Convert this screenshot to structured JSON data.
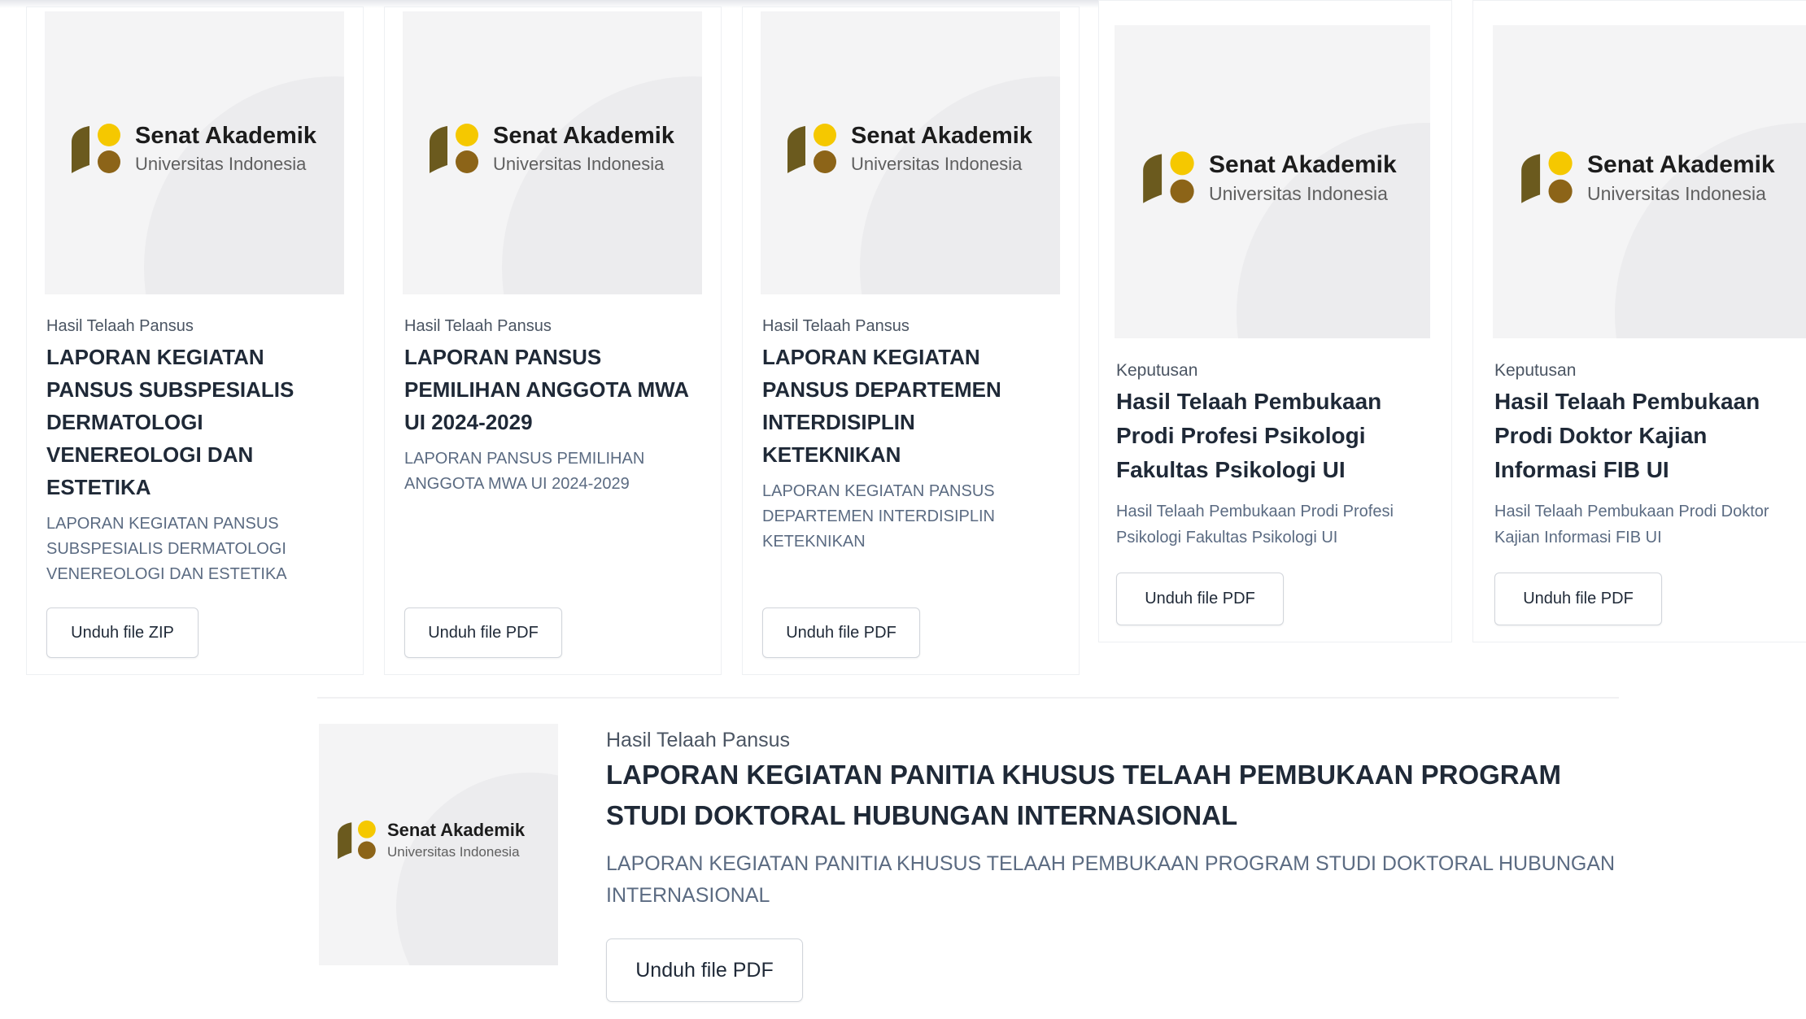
{
  "brand": {
    "name": "Senat Akademik",
    "subtitle": "Universitas Indonesia",
    "colors": {
      "yellow": "#f5c800",
      "brown": "#8c6418",
      "olive": "#6b5a1e"
    }
  },
  "cards": [
    {
      "category": "Hasil Telaah Pansus",
      "title": "LAPORAN KEGIATAN PANSUS SUBSPESIALIS DERMATOLOGI VENEREOLOGI DAN ESTETIKA",
      "description": "LAPORAN KEGIATAN PANSUS SUBSPESIALIS DERMATOLOGI VENEREOLOGI DAN ESTETIKA",
      "button": "Unduh file ZIP"
    },
    {
      "category": "Hasil Telaah Pansus",
      "title": "LAPORAN PANSUS PEMILIHAN ANGGOTA MWA UI 2024-2029",
      "description": "LAPORAN PANSUS PEMILIHAN ANGGOTA MWA UI 2024-2029",
      "button": "Unduh file PDF"
    },
    {
      "category": "Hasil Telaah Pansus",
      "title": "LAPORAN KEGIATAN PANSUS DEPARTEMEN INTERDISIPLIN KETEKNIKAN",
      "description": "LAPORAN KEGIATAN PANSUS DEPARTEMEN INTERDISIPLIN KETEKNIKAN",
      "button": "Unduh file PDF"
    },
    {
      "category": "Keputusan",
      "title": "Hasil Telaah Pembukaan Prodi Profesi Psikologi Fakultas Psikologi UI",
      "description": "Hasil Telaah Pembukaan Prodi Profesi Psikologi Fakultas Psikologi UI",
      "button": "Unduh file PDF"
    },
    {
      "category": "Keputusan",
      "title": "Hasil Telaah Pembukaan Prodi Doktor Kajian Informasi FIB UI",
      "description": "Hasil Telaah Pembukaan Prodi Doktor Kajian Informasi FIB UI",
      "button": "Unduh file PDF"
    }
  ],
  "featured": {
    "category": "Hasil Telaah Pansus",
    "title": "LAPORAN KEGIATAN PANITIA KHUSUS TELAAH PEMBUKAAN PROGRAM STUDI DOKTORAL HUBUNGAN INTERNASIONAL",
    "description": "LAPORAN KEGIATAN PANITIA KHUSUS TELAAH PEMBUKAAN PROGRAM STUDI DOKTORAL HUBUNGAN INTERNASIONAL",
    "button": "Unduh file PDF"
  }
}
